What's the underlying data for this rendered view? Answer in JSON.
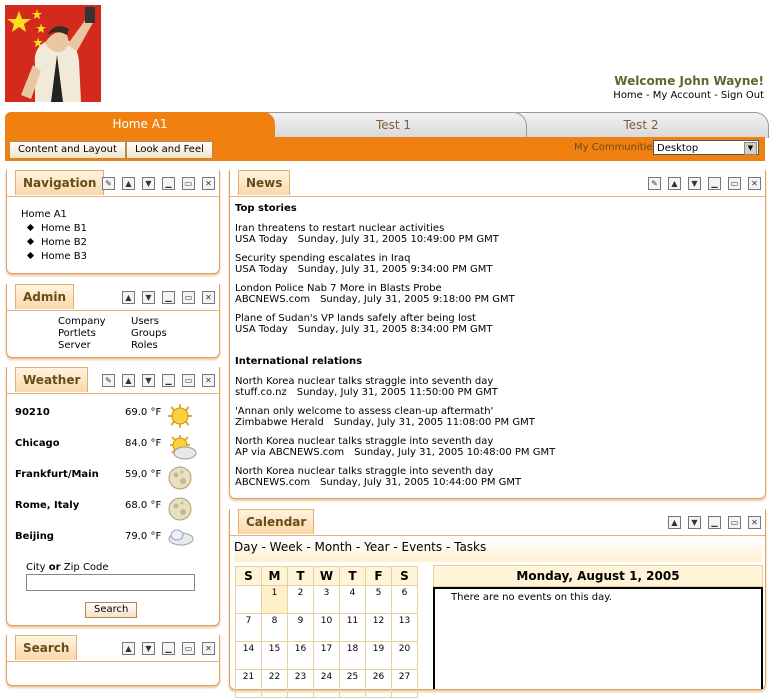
{
  "header": {
    "welcome": "Welcome John Wayne!",
    "links": [
      "Home",
      "My Account",
      "Sign Out"
    ]
  },
  "tabs": [
    {
      "label": "Home A1",
      "active": true
    },
    {
      "label": "Test 1",
      "active": false
    },
    {
      "label": "Test 2",
      "active": false
    }
  ],
  "subbar": {
    "buttons": [
      "Content and Layout",
      "Look and Feel"
    ],
    "communities_label": "My Communities",
    "communities_value": "Desktop"
  },
  "navigation": {
    "title": "Navigation",
    "root": "Home A1",
    "items": [
      "Home B1",
      "Home B2",
      "Home B3"
    ]
  },
  "admin": {
    "title": "Admin",
    "col1": [
      "Company",
      "Portlets",
      "Server"
    ],
    "col2": [
      "Users",
      "Groups",
      "Roles"
    ]
  },
  "weather": {
    "title": "Weather",
    "rows": [
      {
        "city": "90210",
        "temp": "69.0 °F",
        "icon": "sun-icon"
      },
      {
        "city": "Chicago",
        "temp": "84.0 °F",
        "icon": "partly-cloudy-icon"
      },
      {
        "city": "Frankfurt/Main",
        "temp": "59.0 °F",
        "icon": "moon-icon"
      },
      {
        "city": "Rome, Italy",
        "temp": "68.0 °F",
        "icon": "moon-icon"
      },
      {
        "city": "Beijing",
        "temp": "79.0 °F",
        "icon": "cloud-icon"
      }
    ],
    "zip_label_a": "City",
    "zip_label_or": "or",
    "zip_label_b": "Zip Code",
    "search_button": "Search"
  },
  "search": {
    "title": "Search"
  },
  "news": {
    "title": "News",
    "sections": [
      {
        "heading": "Top stories",
        "items": [
          {
            "headline": "Iran threatens to restart nuclear activities",
            "source": "USA Today",
            "date": "Sunday, July 31, 2005 10:49:00 PM GMT"
          },
          {
            "headline": "Security spending escalates in Iraq",
            "source": "USA Today",
            "date": "Sunday, July 31, 2005 9:34:00 PM GMT"
          },
          {
            "headline": "London Police Nab 7 More in Blasts Probe",
            "source": "ABCNEWS.com",
            "date": "Sunday, July 31, 2005 9:18:00 PM GMT"
          },
          {
            "headline": "Plane of Sudan's VP lands safely after being lost",
            "source": "USA Today",
            "date": "Sunday, July 31, 2005 8:34:00 PM GMT"
          }
        ]
      },
      {
        "heading": "International relations",
        "items": [
          {
            "headline": "North Korea nuclear talks straggle into seventh day",
            "source": "stuff.co.nz",
            "date": "Sunday, July 31, 2005 11:50:00 PM GMT"
          },
          {
            "headline": "'Annan only welcome to assess clean-up aftermath'",
            "source": "Zimbabwe Herald",
            "date": "Sunday, July 31, 2005 11:08:00 PM GMT"
          },
          {
            "headline": "North Korea nuclear talks straggle into seventh day",
            "source": "AP via ABCNEWS.com",
            "date": "Sunday, July 31, 2005 10:48:00 PM GMT"
          },
          {
            "headline": "North Korea nuclear talks straggle into seventh day",
            "source": "ABCNEWS.com",
            "date": "Sunday, July 31, 2005 10:44:00 PM GMT"
          }
        ]
      }
    ]
  },
  "calendar": {
    "title": "Calendar",
    "views": [
      "Day",
      "Week",
      "Month",
      "Year",
      "Events",
      "Tasks"
    ],
    "weekdays": [
      "S",
      "M",
      "T",
      "W",
      "T",
      "F",
      "S"
    ],
    "weeks": [
      [
        "",
        "1",
        "2",
        "3",
        "4",
        "5",
        "6"
      ],
      [
        "7",
        "8",
        "9",
        "10",
        "11",
        "12",
        "13"
      ],
      [
        "14",
        "15",
        "16",
        "17",
        "18",
        "19",
        "20"
      ],
      [
        "21",
        "22",
        "23",
        "24",
        "25",
        "26",
        "27"
      ]
    ],
    "selected_date": "Monday, August 1, 2005",
    "no_events": "There are no events on this day."
  },
  "colors": {
    "accent": "#f08010",
    "title_text": "#6b4b1a",
    "welcome": "#556b2f"
  }
}
